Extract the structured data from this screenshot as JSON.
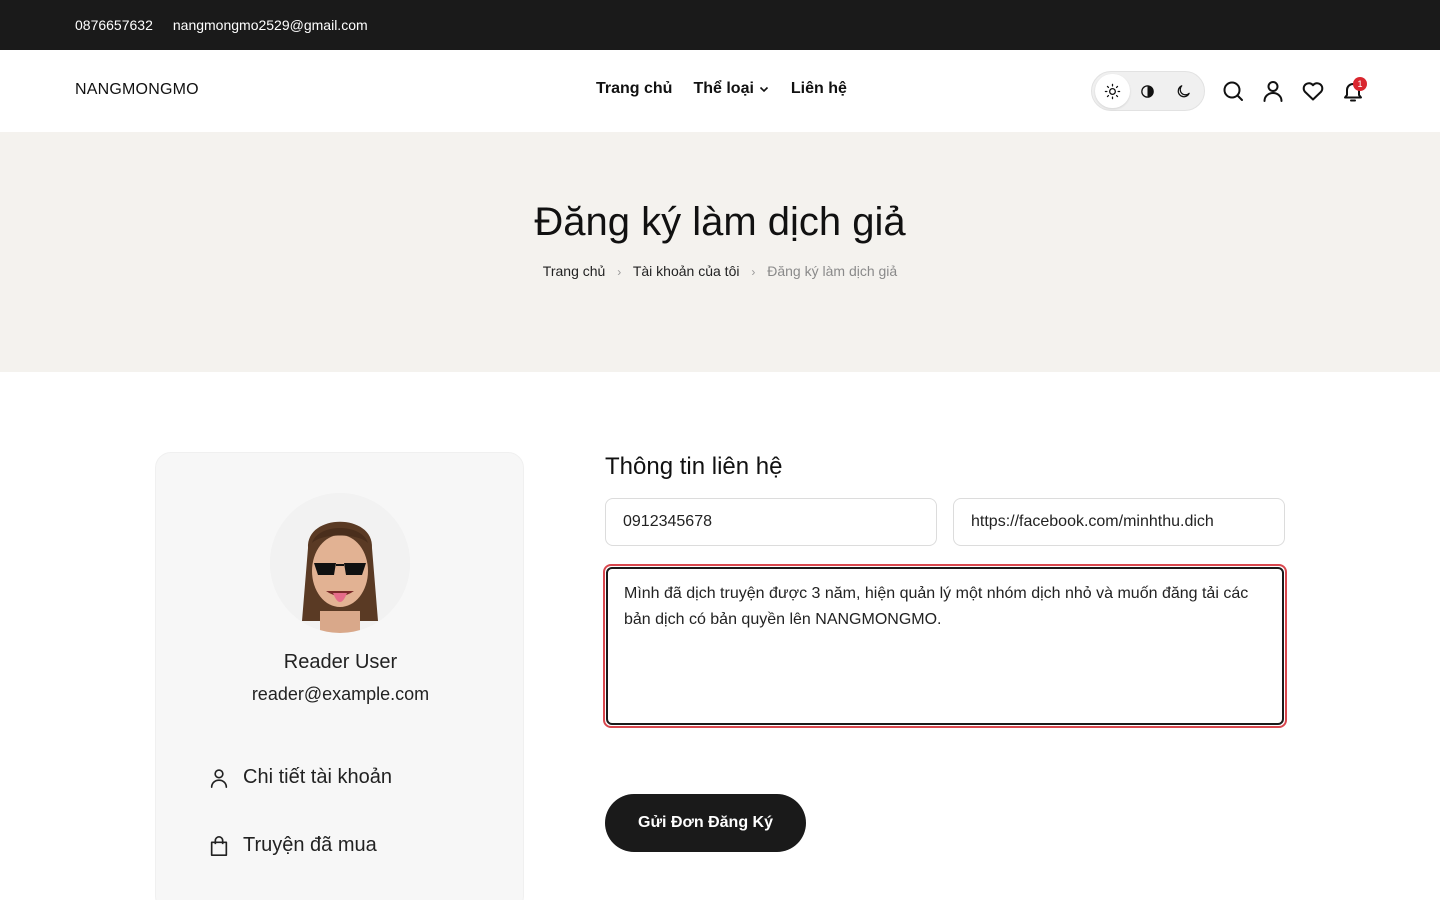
{
  "topbar": {
    "phone": "0876657632",
    "email": "nangmongmo2529@gmail.com"
  },
  "header": {
    "logo": "NANGMONGMO",
    "nav": [
      {
        "label": "Trang chủ"
      },
      {
        "label": "Thể loại"
      },
      {
        "label": "Liên hệ"
      }
    ],
    "notification_count": "1"
  },
  "hero": {
    "title": "Đăng ký làm dịch giả",
    "breadcrumb": [
      "Trang chủ",
      "Tài khoản của tôi",
      "Đăng ký làm dịch giả"
    ]
  },
  "profile": {
    "name": "Reader User",
    "email": "reader@example.com",
    "menu": [
      {
        "label": "Chi tiết tài khoản",
        "icon": "user-icon"
      },
      {
        "label": "Truyện đã mua",
        "icon": "shopping-bag-icon"
      }
    ]
  },
  "form": {
    "title": "Thông tin liên hệ",
    "phone_value": "0912345678",
    "facebook_value": "https://facebook.com/minhthu.dich",
    "message_value": "Mình đã dịch truyện được 3 năm, hiện quản lý một nhóm dịch nhỏ và muốn đăng tải các bản dịch có bản quyền lên NANGMONGMO.",
    "submit_label": "Gửi Đơn Đăng Ký"
  },
  "colors": {
    "dark": "#1a1a1a",
    "hero_bg": "#f4f2ee",
    "card_bg": "#f7f7f7",
    "focus_ring": "#d9474e",
    "badge": "#d9262e"
  }
}
